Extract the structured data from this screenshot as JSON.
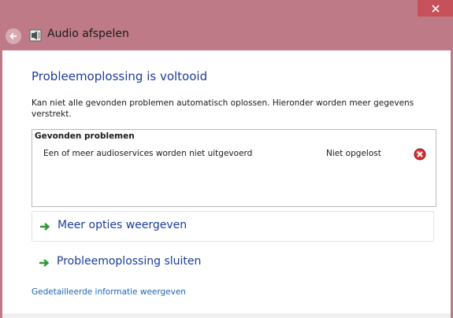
{
  "window": {
    "title": "Audio afspelen",
    "colors": {
      "frame": "#be7b87",
      "close_button": "#c7515a",
      "heading": "#1c3c99",
      "link": "#1c66b5"
    }
  },
  "nav": {
    "back_icon": "back-arrow-icon",
    "app_icon": "speaker-icon"
  },
  "main": {
    "heading": "Probleemoplossing is voltooid",
    "description": "Kan niet alle gevonden problemen automatisch oplossen. Hieronder worden meer gegevens verstrekt.",
    "problems": {
      "header": "Gevonden problemen",
      "items": [
        {
          "description": "Een of meer audioservices worden niet uitgevoerd",
          "status": "Niet opgelost",
          "status_icon": "error-icon"
        }
      ]
    },
    "options": {
      "more": "Meer opties weergeven",
      "close": "Probleemoplossing sluiten"
    },
    "detail_link": "Gedetailleerde informatie weergeven"
  }
}
